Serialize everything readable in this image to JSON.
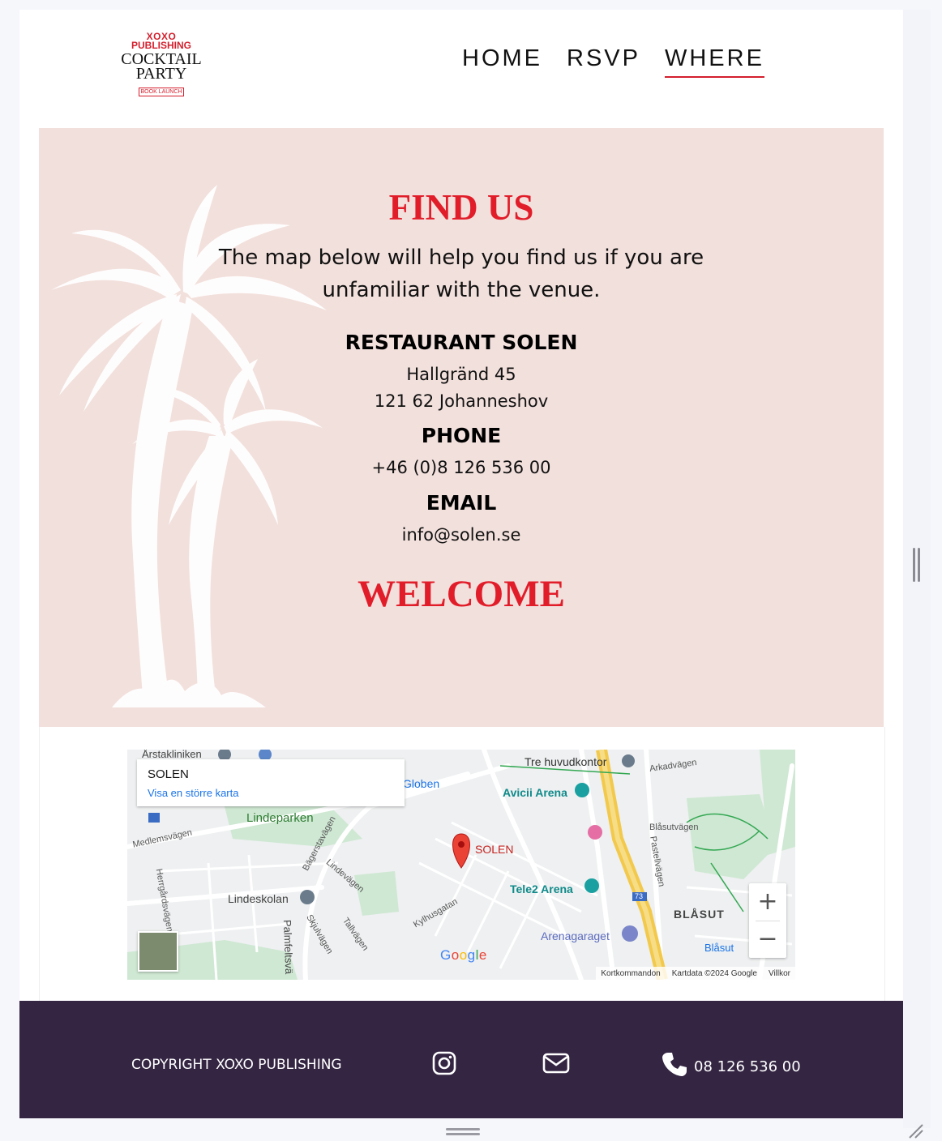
{
  "header": {
    "logo": {
      "line1": "XOXO",
      "line2": "PUBLISHING",
      "line3": "COCKTAIL",
      "line4": "PARTY",
      "line5": "BOOK LAUNCH"
    },
    "nav": [
      {
        "label": "HOME",
        "active": false
      },
      {
        "label": "RSVP",
        "active": false
      },
      {
        "label": "WHERE",
        "active": true
      }
    ]
  },
  "hero": {
    "title": "FIND US",
    "intro": "The map below will help you find us if you are unfamiliar with the venue.",
    "venue_heading": "RESTAURANT SOLEN",
    "address_line1": "Hallgränd 45",
    "address_line2": "121 62 Johanneshov",
    "phone_heading": "PHONE",
    "phone": "+46 (0)8 126 536 00",
    "email_heading": "EMAIL",
    "email": "info@solen.se",
    "welcome": "WELCOME"
  },
  "map": {
    "card_title": "SOLEN",
    "card_link": "Visa en större karta",
    "labels": {
      "arstakliniken": "Årstakliniken",
      "tre_huvudkontor": "Tre huvudkontor",
      "arkadvagen": "Arkadvägen",
      "globen": "Globen",
      "avicii_arena": "Avicii Arena",
      "lindeparken": "Lindeparken",
      "medlemsvagen": "Medlemsvägen",
      "bagerstavagen": "Bägerstavägen",
      "blasutvagen": "Blåsutvägen",
      "pastellvagen": "Pastellvägen",
      "solen_pin": "SOLEN",
      "lindevagen": "Lindevägen",
      "herrgardsvagen": "Herrgårdsvägen",
      "lindeskolan": "Lindeskolan",
      "tele2_arena": "Tele2 Arena",
      "kylhusgatan": "Kylhusgatan",
      "skjulvagen": "Skjulvägen",
      "tallvagen": "Tallvägen",
      "palmfeltsvagen": "Palmfeltsvä",
      "arenagaraget": "Arenagaraget",
      "blasut": "BLÅSUT",
      "blasut_station": "Blåsut",
      "route": "73",
      "google": "Google"
    },
    "zoom_in": "+",
    "zoom_out": "−",
    "attribution": {
      "shortcuts": "Kortkommandon",
      "mapdata": "Kartdata ©2024 Google",
      "terms": "Villkor"
    }
  },
  "footer": {
    "copyright": "COPYRIGHT XOXO PUBLISHING",
    "phone": "08 126 536 00",
    "icons": [
      "instagram-icon",
      "envelope-icon",
      "phone-icon"
    ]
  },
  "colors": {
    "accent_red": "#e21d2a",
    "hero_bg": "#f2e0dc",
    "footer_bg": "#342543",
    "nav_underline": "#d41f2d"
  }
}
